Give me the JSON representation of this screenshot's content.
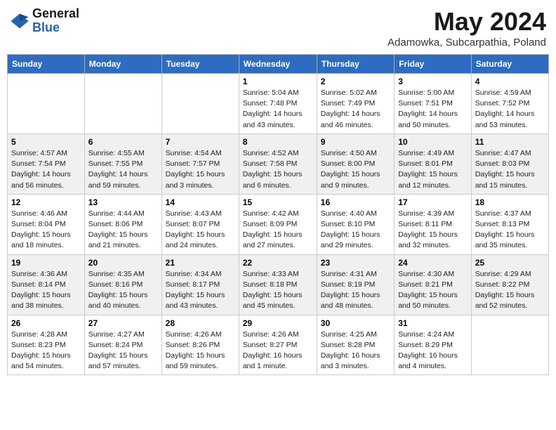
{
  "logo": {
    "general": "General",
    "blue": "Blue"
  },
  "title": "May 2024",
  "subtitle": "Adamowka, Subcarpathia, Poland",
  "weekdays": [
    "Sunday",
    "Monday",
    "Tuesday",
    "Wednesday",
    "Thursday",
    "Friday",
    "Saturday"
  ],
  "weeks": [
    [
      {
        "day": "",
        "sunrise": "",
        "sunset": "",
        "daylight": ""
      },
      {
        "day": "",
        "sunrise": "",
        "sunset": "",
        "daylight": ""
      },
      {
        "day": "",
        "sunrise": "",
        "sunset": "",
        "daylight": ""
      },
      {
        "day": "1",
        "sunrise": "Sunrise: 5:04 AM",
        "sunset": "Sunset: 7:48 PM",
        "daylight": "Daylight: 14 hours and 43 minutes."
      },
      {
        "day": "2",
        "sunrise": "Sunrise: 5:02 AM",
        "sunset": "Sunset: 7:49 PM",
        "daylight": "Daylight: 14 hours and 46 minutes."
      },
      {
        "day": "3",
        "sunrise": "Sunrise: 5:00 AM",
        "sunset": "Sunset: 7:51 PM",
        "daylight": "Daylight: 14 hours and 50 minutes."
      },
      {
        "day": "4",
        "sunrise": "Sunrise: 4:59 AM",
        "sunset": "Sunset: 7:52 PM",
        "daylight": "Daylight: 14 hours and 53 minutes."
      }
    ],
    [
      {
        "day": "5",
        "sunrise": "Sunrise: 4:57 AM",
        "sunset": "Sunset: 7:54 PM",
        "daylight": "Daylight: 14 hours and 56 minutes."
      },
      {
        "day": "6",
        "sunrise": "Sunrise: 4:55 AM",
        "sunset": "Sunset: 7:55 PM",
        "daylight": "Daylight: 14 hours and 59 minutes."
      },
      {
        "day": "7",
        "sunrise": "Sunrise: 4:54 AM",
        "sunset": "Sunset: 7:57 PM",
        "daylight": "Daylight: 15 hours and 3 minutes."
      },
      {
        "day": "8",
        "sunrise": "Sunrise: 4:52 AM",
        "sunset": "Sunset: 7:58 PM",
        "daylight": "Daylight: 15 hours and 6 minutes."
      },
      {
        "day": "9",
        "sunrise": "Sunrise: 4:50 AM",
        "sunset": "Sunset: 8:00 PM",
        "daylight": "Daylight: 15 hours and 9 minutes."
      },
      {
        "day": "10",
        "sunrise": "Sunrise: 4:49 AM",
        "sunset": "Sunset: 8:01 PM",
        "daylight": "Daylight: 15 hours and 12 minutes."
      },
      {
        "day": "11",
        "sunrise": "Sunrise: 4:47 AM",
        "sunset": "Sunset: 8:03 PM",
        "daylight": "Daylight: 15 hours and 15 minutes."
      }
    ],
    [
      {
        "day": "12",
        "sunrise": "Sunrise: 4:46 AM",
        "sunset": "Sunset: 8:04 PM",
        "daylight": "Daylight: 15 hours and 18 minutes."
      },
      {
        "day": "13",
        "sunrise": "Sunrise: 4:44 AM",
        "sunset": "Sunset: 8:06 PM",
        "daylight": "Daylight: 15 hours and 21 minutes."
      },
      {
        "day": "14",
        "sunrise": "Sunrise: 4:43 AM",
        "sunset": "Sunset: 8:07 PM",
        "daylight": "Daylight: 15 hours and 24 minutes."
      },
      {
        "day": "15",
        "sunrise": "Sunrise: 4:42 AM",
        "sunset": "Sunset: 8:09 PM",
        "daylight": "Daylight: 15 hours and 27 minutes."
      },
      {
        "day": "16",
        "sunrise": "Sunrise: 4:40 AM",
        "sunset": "Sunset: 8:10 PM",
        "daylight": "Daylight: 15 hours and 29 minutes."
      },
      {
        "day": "17",
        "sunrise": "Sunrise: 4:39 AM",
        "sunset": "Sunset: 8:11 PM",
        "daylight": "Daylight: 15 hours and 32 minutes."
      },
      {
        "day": "18",
        "sunrise": "Sunrise: 4:37 AM",
        "sunset": "Sunset: 8:13 PM",
        "daylight": "Daylight: 15 hours and 35 minutes."
      }
    ],
    [
      {
        "day": "19",
        "sunrise": "Sunrise: 4:36 AM",
        "sunset": "Sunset: 8:14 PM",
        "daylight": "Daylight: 15 hours and 38 minutes."
      },
      {
        "day": "20",
        "sunrise": "Sunrise: 4:35 AM",
        "sunset": "Sunset: 8:16 PM",
        "daylight": "Daylight: 15 hours and 40 minutes."
      },
      {
        "day": "21",
        "sunrise": "Sunrise: 4:34 AM",
        "sunset": "Sunset: 8:17 PM",
        "daylight": "Daylight: 15 hours and 43 minutes."
      },
      {
        "day": "22",
        "sunrise": "Sunrise: 4:33 AM",
        "sunset": "Sunset: 8:18 PM",
        "daylight": "Daylight: 15 hours and 45 minutes."
      },
      {
        "day": "23",
        "sunrise": "Sunrise: 4:31 AM",
        "sunset": "Sunset: 8:19 PM",
        "daylight": "Daylight: 15 hours and 48 minutes."
      },
      {
        "day": "24",
        "sunrise": "Sunrise: 4:30 AM",
        "sunset": "Sunset: 8:21 PM",
        "daylight": "Daylight: 15 hours and 50 minutes."
      },
      {
        "day": "25",
        "sunrise": "Sunrise: 4:29 AM",
        "sunset": "Sunset: 8:22 PM",
        "daylight": "Daylight: 15 hours and 52 minutes."
      }
    ],
    [
      {
        "day": "26",
        "sunrise": "Sunrise: 4:28 AM",
        "sunset": "Sunset: 8:23 PM",
        "daylight": "Daylight: 15 hours and 54 minutes."
      },
      {
        "day": "27",
        "sunrise": "Sunrise: 4:27 AM",
        "sunset": "Sunset: 8:24 PM",
        "daylight": "Daylight: 15 hours and 57 minutes."
      },
      {
        "day": "28",
        "sunrise": "Sunrise: 4:26 AM",
        "sunset": "Sunset: 8:26 PM",
        "daylight": "Daylight: 15 hours and 59 minutes."
      },
      {
        "day": "29",
        "sunrise": "Sunrise: 4:26 AM",
        "sunset": "Sunset: 8:27 PM",
        "daylight": "Daylight: 16 hours and 1 minute."
      },
      {
        "day": "30",
        "sunrise": "Sunrise: 4:25 AM",
        "sunset": "Sunset: 8:28 PM",
        "daylight": "Daylight: 16 hours and 3 minutes."
      },
      {
        "day": "31",
        "sunrise": "Sunrise: 4:24 AM",
        "sunset": "Sunset: 8:29 PM",
        "daylight": "Daylight: 16 hours and 4 minutes."
      },
      {
        "day": "",
        "sunrise": "",
        "sunset": "",
        "daylight": ""
      }
    ]
  ]
}
